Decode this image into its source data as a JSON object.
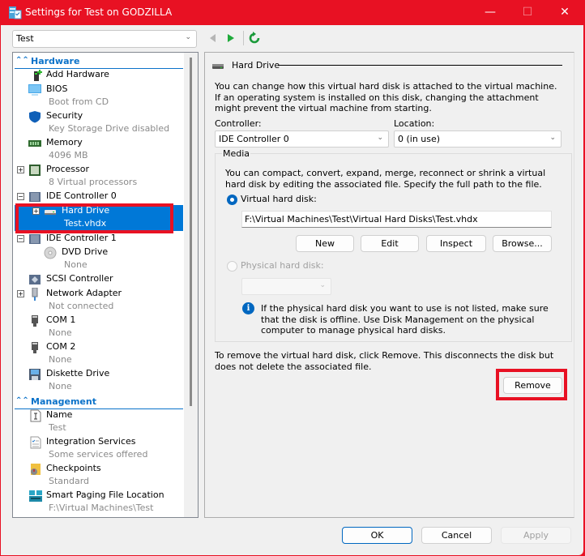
{
  "window": {
    "title": "Settings for Test on GODZILLA",
    "controls": {
      "minimize": "—",
      "maximize": "☐",
      "close": "✕"
    },
    "accent_color": "#e81123"
  },
  "toolbar": {
    "vm_selector": {
      "value": "Test"
    },
    "back_icon": "triangle-left",
    "forward_icon": "triangle-right",
    "refresh_icon": "circular-arrow"
  },
  "tree": {
    "sections": [
      {
        "label": "Hardware",
        "icon": "collapse-chevrons-up"
      },
      {
        "label": "Management",
        "icon": "collapse-chevrons-up"
      }
    ],
    "hardware_items": [
      {
        "name": "Add Hardware",
        "sub": ""
      },
      {
        "name": "BIOS",
        "sub": "Boot from CD"
      },
      {
        "name": "Security",
        "sub": "Key Storage Drive disabled"
      },
      {
        "name": "Memory",
        "sub": "4096 MB"
      },
      {
        "name": "Processor",
        "sub": "8 Virtual processors",
        "expander": "+"
      },
      {
        "name": "IDE Controller 0",
        "sub": "",
        "expander": "−"
      },
      {
        "name": "Hard Drive",
        "sub": "Test.vhdx",
        "expander": "+",
        "selected": true
      },
      {
        "name": "IDE Controller 1",
        "sub": "",
        "expander": "−"
      },
      {
        "name": "DVD Drive",
        "sub": "None"
      },
      {
        "name": "SCSI Controller",
        "sub": ""
      },
      {
        "name": "Network Adapter",
        "sub": "Not connected",
        "expander": "+"
      },
      {
        "name": "COM 1",
        "sub": "None"
      },
      {
        "name": "COM 2",
        "sub": "None"
      },
      {
        "name": "Diskette Drive",
        "sub": "None"
      }
    ],
    "management_items": [
      {
        "name": "Name",
        "sub": "Test"
      },
      {
        "name": "Integration Services",
        "sub": "Some services offered"
      },
      {
        "name": "Checkpoints",
        "sub": "Standard"
      },
      {
        "name": "Smart Paging File Location",
        "sub": "F:\\Virtual Machines\\Test"
      }
    ]
  },
  "panel": {
    "header": "Hard Drive",
    "intro": "You can change how this virtual hard disk is attached to the virtual machine. If an operating system is installed on this disk, changing the attachment might prevent the virtual machine from starting.",
    "controller_label": "Controller:",
    "controller_value": "IDE Controller 0",
    "location_label": "Location:",
    "location_value": "0 (in use)",
    "media": {
      "legend": "Media",
      "description": "You can compact, convert, expand, merge, reconnect or shrink a virtual hard disk by editing the associated file. Specify the full path to the file.",
      "virtual_disk_label": "Virtual hard disk:",
      "virtual_disk_selected": true,
      "virtual_disk_path": "F:\\Virtual Machines\\Test\\Virtual Hard Disks\\Test.vhdx",
      "buttons": {
        "new": "New",
        "edit": "Edit",
        "inspect": "Inspect",
        "browse": "Browse..."
      },
      "physical_disk_label": "Physical hard disk:",
      "physical_disk_selected": false,
      "physical_disk_value": "",
      "info_text": "If the physical hard disk you want to use is not listed, make sure that the disk is offline. Use Disk Management on the physical computer to manage physical hard disks."
    },
    "remove_text": "To remove the virtual hard disk, click Remove. This disconnects the disk but does not delete the associated file.",
    "remove_button": "Remove"
  },
  "footer": {
    "ok": "OK",
    "cancel": "Cancel",
    "apply": "Apply"
  }
}
